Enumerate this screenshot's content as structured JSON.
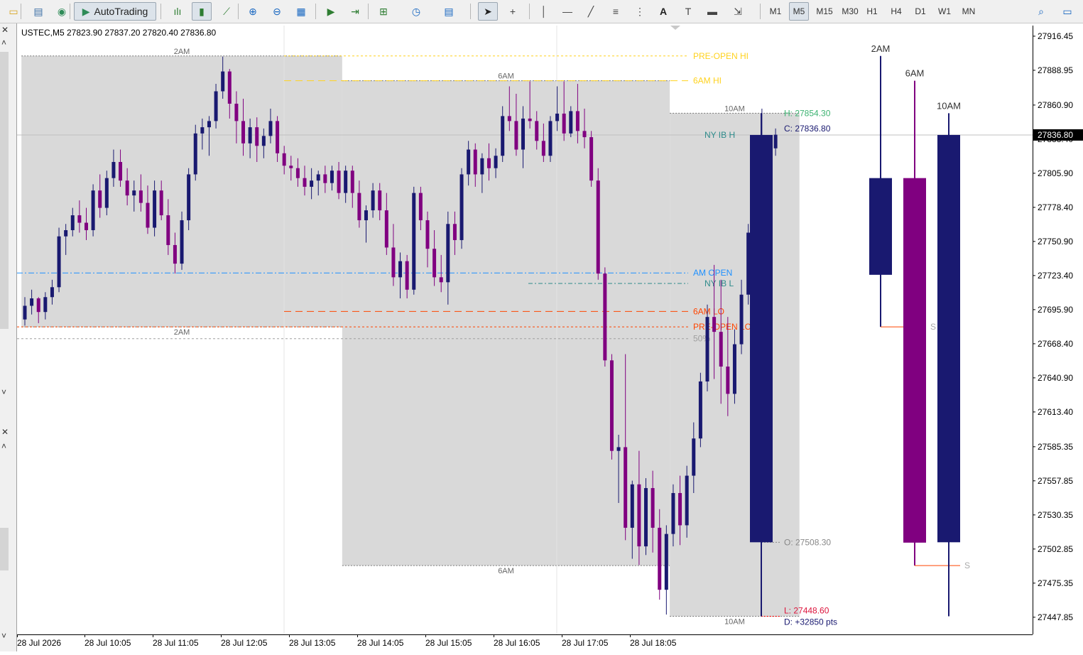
{
  "toolbar": {
    "autotrading_label": "AutoTrading",
    "text_tool_label": "A",
    "timeframes": [
      "M1",
      "M5",
      "M15",
      "M30",
      "H1",
      "H4",
      "D1",
      "W1",
      "MN"
    ],
    "active_timeframe": "M5"
  },
  "symbol_info": "USTEC,M5  27823.90 27837.20 27820.40 27836.80",
  "colors": {
    "bull": "#191970",
    "bear": "#800080",
    "box": "#d9d9d9",
    "pre_open": "#ffd21e",
    "am_open": "#1e90ff",
    "ib": "#2e8b8b",
    "lo": "#ff4500",
    "grid": "#c0c0c0"
  },
  "icons": [
    "chart-icon",
    "folder-icon",
    "market-watch-icon",
    "autotrading-icon",
    "bar-chart-icon",
    "candle-chart-icon",
    "line-chart-icon",
    "zoom-in-icon",
    "zoom-out-icon",
    "tile-windows-icon",
    "autoscroll-icon",
    "chart-shift-icon",
    "indicators-icon",
    "periods-icon",
    "templates-icon",
    "cursor-icon",
    "crosshair-icon",
    "vertical-line-icon",
    "horizontal-line-icon",
    "trendline-icon",
    "fibo-icon",
    "grid-tool-icon",
    "text-icon",
    "text-label-icon",
    "rectangle-icon",
    "arrows-icon",
    "search-icon",
    "chat-icon"
  ],
  "chart_data": {
    "type": "candlestick",
    "symbol": "USTEC",
    "timeframe": "M5",
    "ylim": [
      27434,
      27925
    ],
    "price_ticks": [
      "27916.45",
      "27888.95",
      "27860.90",
      "27833.40",
      "27805.90",
      "27778.40",
      "27750.90",
      "27723.40",
      "27695.90",
      "27668.40",
      "27640.90",
      "27613.40",
      "27585.35",
      "27557.85",
      "27530.35",
      "27502.85",
      "27475.35",
      "27447.85"
    ],
    "current_price": "27836.80",
    "time_labels": [
      "28 Jul 2026",
      "28 Jul 10:05",
      "28 Jul 11:05",
      "28 Jul 12:05",
      "28 Jul 13:05",
      "28 Jul 14:05",
      "28 Jul 15:05",
      "28 Jul 16:05",
      "28 Jul 17:05",
      "28 Jul 18:05"
    ],
    "session_boxes": [
      {
        "name": "2AM",
        "start_index": 0,
        "end_index": 46,
        "high": 27900.5,
        "low": 27682.0,
        "label": "2AM"
      },
      {
        "name": "6AM",
        "start_index": 47,
        "end_index": 94,
        "high": 27880.5,
        "low": 27489.5,
        "label": "6AM"
      },
      {
        "name": "10AM",
        "start_index": 95,
        "end_index": 113,
        "high": 27854.3,
        "low": 27448.6,
        "label": "10AM"
      }
    ],
    "levels": [
      {
        "name": "PRE-OPEN HI",
        "price": 27900.5,
        "color": "#ffd21e",
        "label": "PRE-OPEN HI"
      },
      {
        "name": "6AM HI",
        "price": 27880.5,
        "color": "#ffd21e",
        "label": "6AM HI"
      },
      {
        "name": "NY IB H",
        "price": 27836.8,
        "color": "#2e8b8b",
        "label": "NY IB H"
      },
      {
        "name": "AM OPEN",
        "price": 27725.5,
        "color": "#1e90ff",
        "label": "AM OPEN"
      },
      {
        "name": "NY IB L",
        "price": 27717.0,
        "color": "#2e8b8b",
        "label": "NY IB L"
      },
      {
        "name": "6AM LO",
        "price": 27694.5,
        "color": "#ff4500",
        "label": "6AM LO"
      },
      {
        "name": "PRE-OPEN LO",
        "price": 27682.0,
        "color": "#ff4500",
        "label": "PRE-OPEN LO"
      },
      {
        "name": "50%",
        "price": 27672.5,
        "color": "#a0a0a0",
        "label": "50%"
      }
    ],
    "stats": {
      "high": "H: 27854.30",
      "close": "C: 27836.80",
      "open": "O: 27508.30",
      "low": "L: 27448.60",
      "range": "D: +32850 pts"
    },
    "summary_candles": [
      {
        "label": "",
        "open": 27508.3,
        "high": 27854.3,
        "low": 27448.6,
        "close": 27836.8,
        "bull": true
      },
      {
        "label": "2AM",
        "open": 27724.0,
        "high": 27900.5,
        "low": 27682.0,
        "close": 27802.0,
        "bull": true,
        "s_level": 27682.0
      },
      {
        "label": "6AM",
        "open": 27802.0,
        "high": 27880.5,
        "low": 27489.5,
        "close": 27508.0,
        "bull": false,
        "s_level": 27489.5
      },
      {
        "label": "10AM",
        "open": 27508.3,
        "high": 27854.3,
        "low": 27448.6,
        "close": 27836.8,
        "bull": true
      }
    ],
    "s_marker": "S",
    "candles": [
      [
        27688,
        27706,
        27683,
        27699
      ],
      [
        27699,
        27712,
        27692,
        27705
      ],
      [
        27705,
        27706,
        27685,
        27694
      ],
      [
        27694,
        27710,
        27688,
        27706
      ],
      [
        27706,
        27720,
        27700,
        27714
      ],
      [
        27714,
        27762,
        27710,
        27755
      ],
      [
        27755,
        27765,
        27740,
        27760
      ],
      [
        27760,
        27778,
        27755,
        27772
      ],
      [
        27772,
        27784,
        27758,
        27766
      ],
      [
        27766,
        27778,
        27752,
        27760
      ],
      [
        27760,
        27797,
        27755,
        27792
      ],
      [
        27792,
        27805,
        27770,
        27778
      ],
      [
        27778,
        27808,
        27772,
        27802
      ],
      [
        27802,
        27825,
        27795,
        27815
      ],
      [
        27815,
        27825,
        27795,
        27800
      ],
      [
        27800,
        27810,
        27780,
        27788
      ],
      [
        27788,
        27800,
        27775,
        27792
      ],
      [
        27792,
        27805,
        27775,
        27782
      ],
      [
        27782,
        27796,
        27757,
        27762
      ],
      [
        27762,
        27800,
        27755,
        27792
      ],
      [
        27792,
        27800,
        27768,
        27772
      ],
      [
        27772,
        27785,
        27740,
        27748
      ],
      [
        27748,
        27758,
        27725,
        27733
      ],
      [
        27733,
        27775,
        27728,
        27768
      ],
      [
        27768,
        27810,
        27760,
        27805
      ],
      [
        27805,
        27845,
        27800,
        27838
      ],
      [
        27838,
        27850,
        27825,
        27843
      ],
      [
        27843,
        27852,
        27820,
        27848
      ],
      [
        27848,
        27878,
        27842,
        27872
      ],
      [
        27872,
        27900,
        27866,
        27888
      ],
      [
        27888,
        27890,
        27850,
        27862
      ],
      [
        27862,
        27872,
        27830,
        27848
      ],
      [
        27848,
        27866,
        27820,
        27830
      ],
      [
        27830,
        27850,
        27818,
        27843
      ],
      [
        27843,
        27851,
        27815,
        27828
      ],
      [
        27828,
        27842,
        27818,
        27836
      ],
      [
        27836,
        27858,
        27830,
        27848
      ],
      [
        27848,
        27852,
        27815,
        27822
      ],
      [
        27822,
        27828,
        27805,
        27812
      ],
      [
        27812,
        27820,
        27800,
        27810
      ],
      [
        27810,
        27818,
        27795,
        27802
      ],
      [
        27802,
        27812,
        27788,
        27795
      ],
      [
        27795,
        27810,
        27785,
        27800
      ],
      [
        27800,
        27808,
        27788,
        27805
      ],
      [
        27805,
        27812,
        27790,
        27798
      ],
      [
        27798,
        27812,
        27792,
        27808
      ],
      [
        27808,
        27815,
        27785,
        27790
      ],
      [
        27790,
        27812,
        27782,
        27808
      ],
      [
        27808,
        27812,
        27778,
        27790
      ],
      [
        27790,
        27800,
        27762,
        27768
      ],
      [
        27768,
        27780,
        27750,
        27776
      ],
      [
        27776,
        27798,
        27770,
        27792
      ],
      [
        27792,
        27798,
        27768,
        27776
      ],
      [
        27776,
        27790,
        27740,
        27746
      ],
      [
        27746,
        27765,
        27715,
        27722
      ],
      [
        27722,
        27742,
        27705,
        27735
      ],
      [
        27735,
        27740,
        27705,
        27712
      ],
      [
        27712,
        27795,
        27708,
        27790
      ],
      [
        27790,
        27795,
        27760,
        27768
      ],
      [
        27768,
        27775,
        27730,
        27745
      ],
      [
        27745,
        27760,
        27715,
        27722
      ],
      [
        27722,
        27740,
        27710,
        27718
      ],
      [
        27718,
        27775,
        27700,
        27765
      ],
      [
        27765,
        27775,
        27740,
        27752
      ],
      [
        27752,
        27810,
        27745,
        27805
      ],
      [
        27805,
        27832,
        27796,
        27825
      ],
      [
        27825,
        27830,
        27795,
        27805
      ],
      [
        27805,
        27822,
        27790,
        27818
      ],
      [
        27818,
        27830,
        27800,
        27810
      ],
      [
        27810,
        27826,
        27802,
        27820
      ],
      [
        27820,
        27860,
        27815,
        27852
      ],
      [
        27852,
        27876,
        27840,
        27848
      ],
      [
        27848,
        27870,
        27820,
        27825
      ],
      [
        27825,
        27860,
        27810,
        27850
      ],
      [
        27850,
        27880,
        27842,
        27848
      ],
      [
        27848,
        27856,
        27825,
        27832
      ],
      [
        27832,
        27846,
        27815,
        27820
      ],
      [
        27820,
        27852,
        27815,
        27848
      ],
      [
        27848,
        27876,
        27840,
        27854
      ],
      [
        27854,
        27880,
        27832,
        27838
      ],
      [
        27838,
        27860,
        27835,
        27856
      ],
      [
        27856,
        27878,
        27830,
        27840
      ],
      [
        27840,
        27858,
        27826,
        27835
      ],
      [
        27835,
        27840,
        27795,
        27800
      ],
      [
        27800,
        27810,
        27720,
        27725
      ],
      [
        27725,
        27730,
        27650,
        27655
      ],
      [
        27655,
        27660,
        27575,
        27582
      ],
      [
        27582,
        27595,
        27540,
        27585
      ],
      [
        27585,
        27660,
        27510,
        27520
      ],
      [
        27520,
        27558,
        27495,
        27555
      ],
      [
        27555,
        27582,
        27490,
        27505
      ],
      [
        27505,
        27560,
        27498,
        27552
      ],
      [
        27552,
        27566,
        27500,
        27520
      ],
      [
        27520,
        27535,
        27462,
        27470
      ],
      [
        27470,
        27522,
        27450,
        27515
      ],
      [
        27515,
        27555,
        27505,
        27548
      ],
      [
        27548,
        27562,
        27506,
        27522
      ],
      [
        27522,
        27570,
        27512,
        27562
      ],
      [
        27562,
        27605,
        27548,
        27592
      ],
      [
        27592,
        27645,
        27585,
        27638
      ],
      [
        27638,
        27700,
        27630,
        27690
      ],
      [
        27690,
        27732,
        27640,
        27678
      ],
      [
        27678,
        27720,
        27620,
        27650
      ],
      [
        27650,
        27690,
        27610,
        27628
      ],
      [
        27628,
        27680,
        27620,
        27668
      ],
      [
        27668,
        27720,
        27660,
        27708
      ],
      [
        27708,
        27765,
        27700,
        27758
      ],
      [
        27758,
        27815,
        27752,
        27808
      ],
      [
        27808,
        27858,
        27790,
        27818
      ],
      [
        27818,
        27832,
        27800,
        27826
      ],
      [
        27826,
        27842,
        27820,
        27837
      ]
    ]
  }
}
